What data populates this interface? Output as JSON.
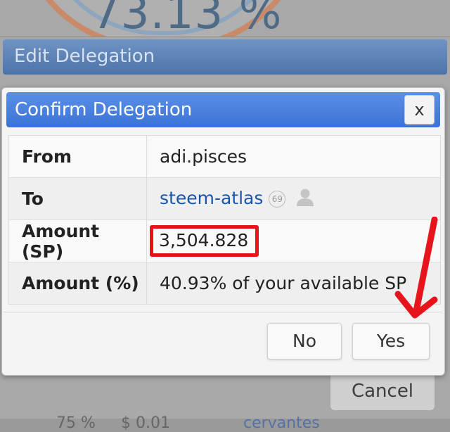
{
  "background": {
    "gauge_percent": "73.13 %",
    "edit_dialog_title": "Edit Delegation",
    "cancel_label": "Cancel",
    "bottom_row": [
      "75 %",
      "$ 0.01",
      "cervantes"
    ]
  },
  "confirm": {
    "title": "Confirm Delegation",
    "close_label": "x",
    "rows": [
      {
        "label": "From",
        "value": "adi.pisces"
      },
      {
        "label": "To",
        "value": "steem-atlas",
        "reputation": "69"
      },
      {
        "label": "Amount (SP)",
        "value": "3,504.828"
      },
      {
        "label": "Amount (%)",
        "value": "40.93% of your available SP"
      }
    ],
    "no_label": "No",
    "yes_label": "Yes"
  },
  "colors": {
    "header_blue": "#3b73d6",
    "link_blue": "#1a56a8",
    "highlight_red": "#e8141b"
  },
  "icons": [
    "user-silhouette-icon",
    "red-arrow-annotation"
  ]
}
